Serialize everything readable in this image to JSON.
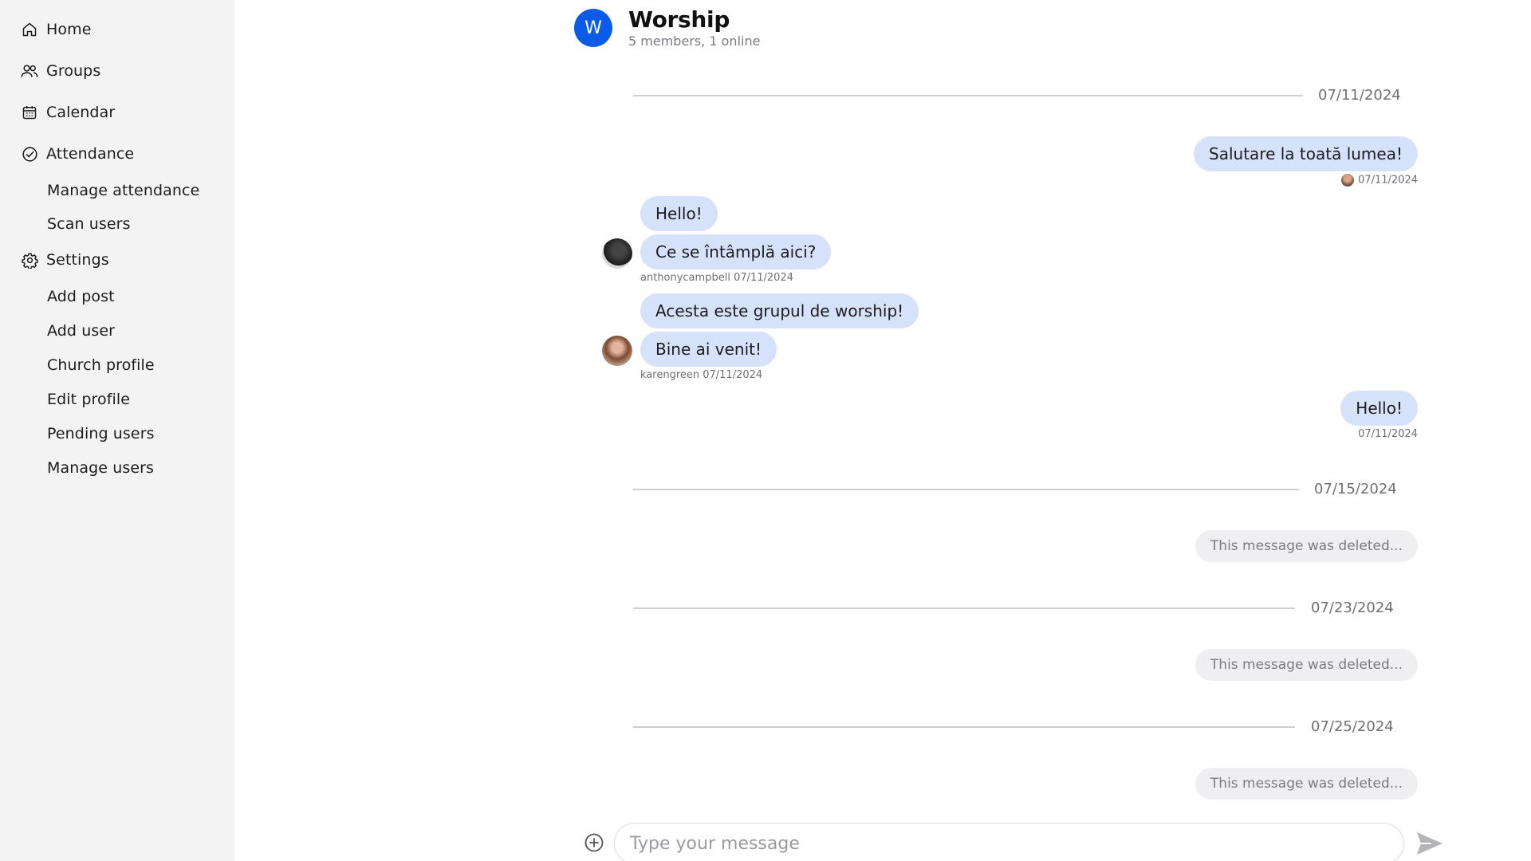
{
  "sidebar": {
    "items": [
      {
        "label": "Home",
        "icon": "home-icon"
      },
      {
        "label": "Groups",
        "icon": "groups-icon"
      },
      {
        "label": "Calendar",
        "icon": "calendar-icon"
      },
      {
        "label": "Attendance",
        "icon": "check-circle-icon"
      },
      {
        "label": "Manage attendance"
      },
      {
        "label": "Scan users"
      },
      {
        "label": "Settings",
        "icon": "gear-icon"
      },
      {
        "label": "Add post"
      },
      {
        "label": "Add user"
      },
      {
        "label": "Church profile"
      },
      {
        "label": "Edit profile"
      },
      {
        "label": "Pending users"
      },
      {
        "label": "Manage users"
      }
    ]
  },
  "chat": {
    "avatar_letter": "W",
    "title": "Worship",
    "subtitle": "5 members, 1 online",
    "accent_color": "#0a5ce8",
    "bubble_color": "#d6e2f9",
    "separators": [
      "07/11/2024",
      "07/15/2024",
      "07/23/2024",
      "07/25/2024"
    ],
    "messages": [
      {
        "text": "Salutare la toată lumea!",
        "meta": "07/11/2024"
      },
      {
        "text": "Hello!"
      },
      {
        "text": "Ce se întâmplă aici?",
        "meta": "anthonycampbell 07/11/2024"
      },
      {
        "text": "Acesta este grupul de worship!"
      },
      {
        "text": "Bine ai venit!",
        "meta": "karengreen 07/11/2024"
      },
      {
        "text": "Hello!",
        "meta": "07/11/2024"
      }
    ],
    "deleted_text": "This message was deleted..."
  },
  "composer": {
    "placeholder": "Type your message"
  }
}
